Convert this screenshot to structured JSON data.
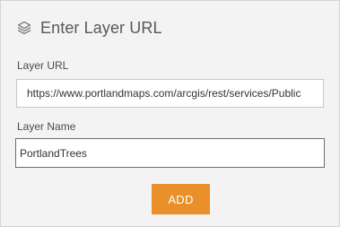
{
  "header": {
    "icon": "layers-icon",
    "title": "Enter Layer URL"
  },
  "form": {
    "url_label": "Layer URL",
    "url_value": "https://www.portlandmaps.com/arcgis/rest/services/Public",
    "name_label": "Layer Name",
    "name_value": "PortlandTrees",
    "add_label": "ADD"
  },
  "colors": {
    "accent": "#e9902b",
    "panel_bg": "#f3f3f3",
    "text": "#595959"
  }
}
